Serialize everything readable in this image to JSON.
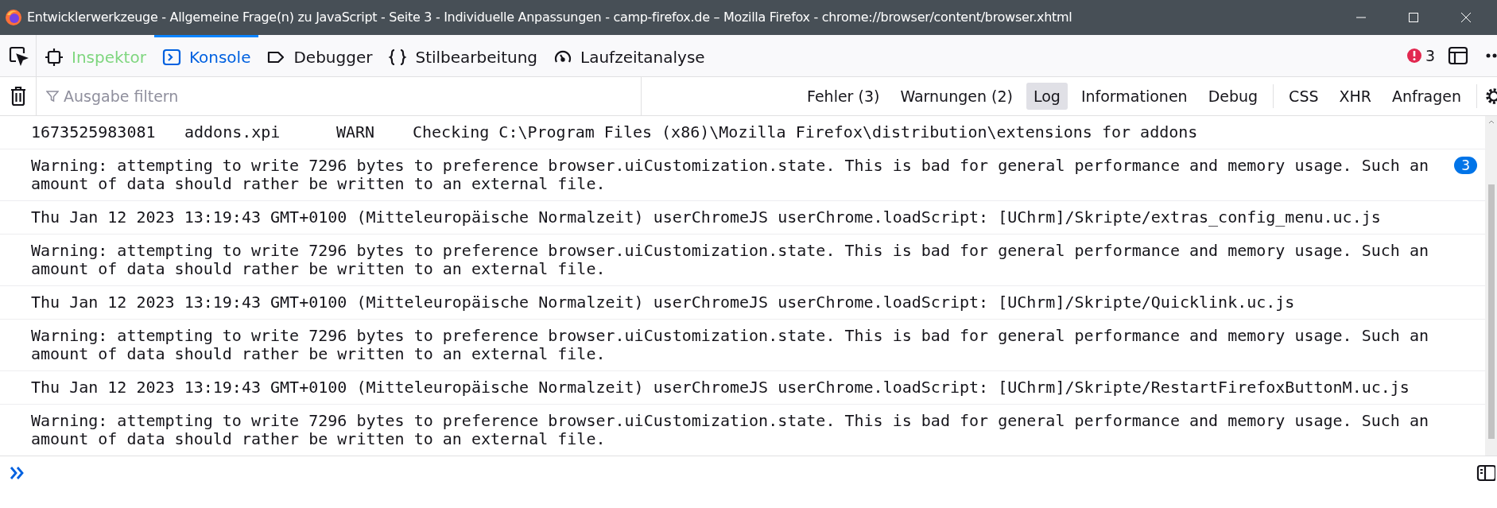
{
  "window": {
    "title": "Entwicklerwerkzeuge - Allgemeine Frage(n) zu JavaScript - Seite 3 - Individuelle Anpassungen - camp-firefox.de – Mozilla Firefox - chrome://browser/content/browser.xhtml"
  },
  "tabs": [
    {
      "label": "Inspektor",
      "selected": false,
      "hovered": true
    },
    {
      "label": "Konsole",
      "selected": true,
      "hovered": false
    },
    {
      "label": "Debugger",
      "selected": false,
      "hovered": false
    },
    {
      "label": "Stilbearbeitung",
      "selected": false,
      "hovered": false
    },
    {
      "label": "Laufzeitanalyse",
      "selected": false,
      "hovered": false
    }
  ],
  "error_count": "3",
  "filter": {
    "placeholder": "Ausgabe filtern"
  },
  "filter_groups": [
    [
      {
        "label": "Fehler (3)",
        "selected": false
      },
      {
        "label": "Warnungen (2)",
        "selected": false
      },
      {
        "label": "Log",
        "selected": true
      },
      {
        "label": "Informationen",
        "selected": false
      },
      {
        "label": "Debug",
        "selected": false
      }
    ],
    [
      {
        "label": "CSS",
        "selected": false
      },
      {
        "label": "XHR",
        "selected": false
      },
      {
        "label": "Anfragen",
        "selected": false
      }
    ]
  ],
  "messages": [
    {
      "kind": "columns",
      "columns": [
        "1673525983081",
        "addons.xpi",
        "WARN",
        "Checking C:\\Program Files (x86)\\Mozilla Firefox\\distribution\\extensions for addons"
      ]
    },
    {
      "kind": "text",
      "lines": [
        "Warning: attempting to write 7296 bytes to preference browser.uiCustomization.state. This is bad for general performance and memory usage. Such an",
        "amount of data should rather be written to an external file."
      ],
      "repeat": "3"
    },
    {
      "kind": "text",
      "lines": [
        "Thu Jan 12 2023 13:19:43 GMT+0100 (Mitteleuropäische Normalzeit) userChromeJS userChrome.loadScript: [UChrm]/Skripte/extras_config_menu.uc.js"
      ]
    },
    {
      "kind": "text",
      "lines": [
        "Warning: attempting to write 7296 bytes to preference browser.uiCustomization.state. This is bad for general performance and memory usage. Such an",
        "amount of data should rather be written to an external file."
      ]
    },
    {
      "kind": "text",
      "lines": [
        "Thu Jan 12 2023 13:19:43 GMT+0100 (Mitteleuropäische Normalzeit) userChromeJS userChrome.loadScript: [UChrm]/Skripte/Quicklink.uc.js"
      ]
    },
    {
      "kind": "text",
      "lines": [
        "Warning: attempting to write 7296 bytes to preference browser.uiCustomization.state. This is bad for general performance and memory usage. Such an",
        "amount of data should rather be written to an external file."
      ]
    },
    {
      "kind": "text",
      "lines": [
        "Thu Jan 12 2023 13:19:43 GMT+0100 (Mitteleuropäische Normalzeit) userChromeJS userChrome.loadScript: [UChrm]/Skripte/RestartFirefoxButtonM.uc.js"
      ]
    },
    {
      "kind": "text",
      "lines": [
        "Warning: attempting to write 7296 bytes to preference browser.uiCustomization.state. This is bad for general performance and memory usage. Such an",
        "amount of data should rather be written to an external file."
      ]
    }
  ]
}
